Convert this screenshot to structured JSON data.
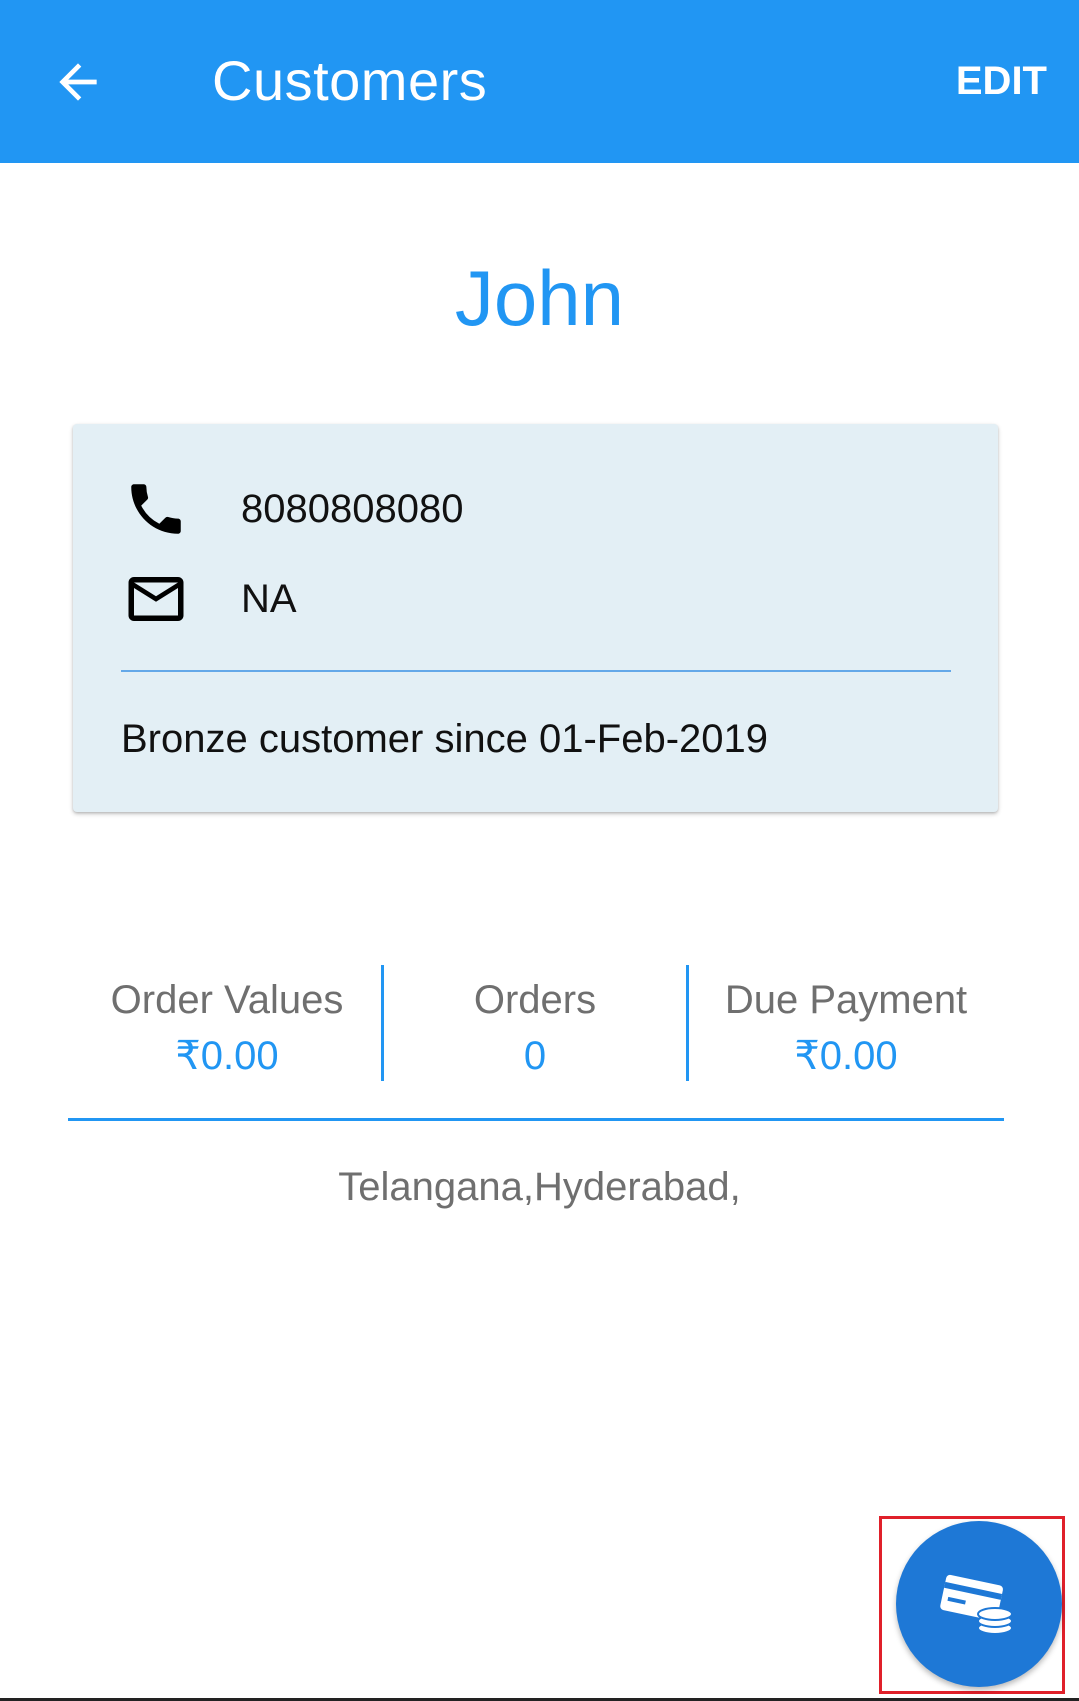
{
  "appbar": {
    "title": "Customers",
    "back_icon": "arrow-left-icon",
    "edit_label": "EDIT",
    "color": "#2196F3"
  },
  "customer": {
    "name": "John",
    "phone": "8080808080",
    "email": "NA",
    "since": "Bronze customer since 01-Feb-2019",
    "address": "Telangana,Hyderabad,"
  },
  "icons": {
    "phone": "phone-icon",
    "email": "mail-icon",
    "fab": "card-payment-icon"
  },
  "stats": [
    {
      "label": "Order Values",
      "value": "₹0.00"
    },
    {
      "label": "Orders",
      "value": "0"
    },
    {
      "label": "Due Payment",
      "value": "₹0.00"
    }
  ],
  "colors": {
    "accent": "#2196F3",
    "card_bg": "#E3EFF5",
    "fab": "#1E78D6",
    "highlight": "#e0202a"
  }
}
